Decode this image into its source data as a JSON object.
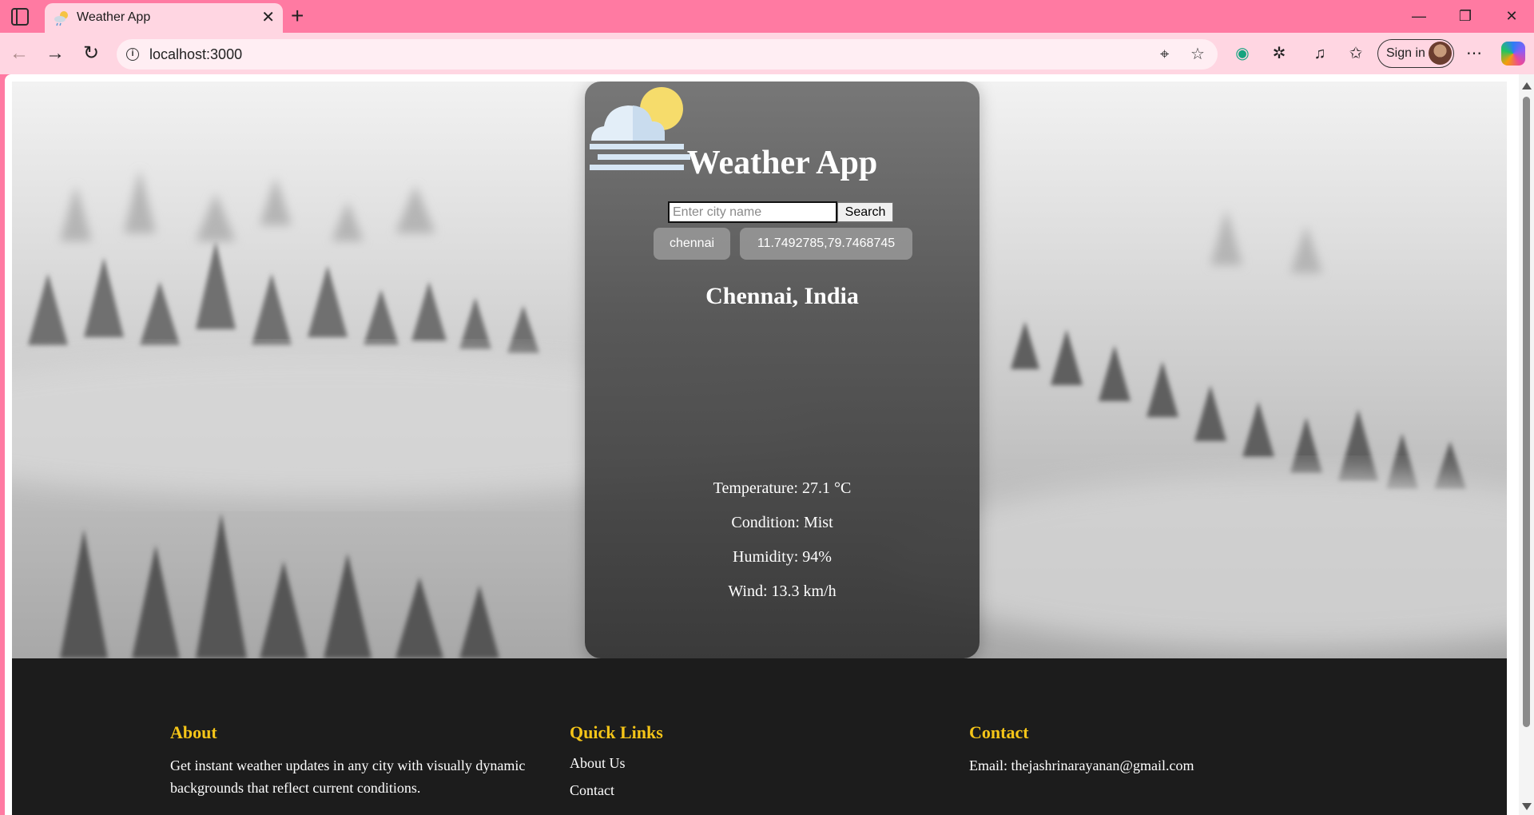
{
  "browser": {
    "tab_title": "Weather App",
    "url": "localhost:3000",
    "sign_in_label": "Sign in",
    "tab_close_glyph": "✕",
    "new_tab_glyph": "+"
  },
  "app": {
    "title": "Weather App",
    "search": {
      "placeholder": "Enter city name",
      "value": "",
      "button_label": "Search"
    },
    "chips": [
      "chennai",
      "11.7492785,79.7468745"
    ],
    "location": "Chennai, India",
    "weather_icon": "cloud-sun-mist-icon",
    "stats": {
      "temperature": "Temperature: 27.1 °C",
      "condition": "Condition: Mist",
      "humidity": "Humidity: 94%",
      "wind": "Wind: 13.3 km/h"
    }
  },
  "footer": {
    "about": {
      "heading": "About",
      "text": "Get instant weather updates in any city with visually dynamic backgrounds that reflect current conditions."
    },
    "quick_links": {
      "heading": "Quick Links",
      "links": [
        "About Us",
        "Contact"
      ]
    },
    "contact": {
      "heading": "Contact",
      "email": "Email: thejashrinarayanan@gmail.com"
    }
  },
  "colors": {
    "chrome_pink": "#ff7aa2",
    "toolbar_pink": "#ffd6e2",
    "footer_bg": "#1c1c1c",
    "footer_heading": "#f5c518",
    "sun": "#f6dc6b",
    "cloud": "#d6e6f4"
  }
}
